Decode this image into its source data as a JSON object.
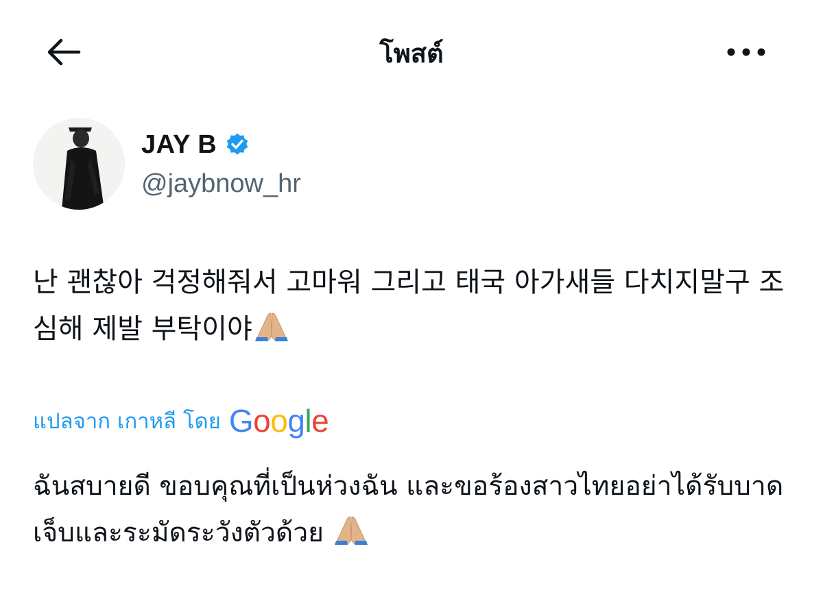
{
  "header": {
    "title": "โพสต์",
    "back_icon": "arrow-left-icon",
    "more_icon": "more-horizontal-icon"
  },
  "author": {
    "name": "JAY B",
    "handle": "@jaybnow_hr",
    "verified": true,
    "verified_color": "#1d9bf0"
  },
  "post": {
    "text": "난 괜찮아 걱정해줘서 고마워 그리고 태국 아가새들 다치지말구 조심해 제발 부탁이야",
    "emoji": "folded-hands-icon"
  },
  "translation": {
    "label": "แปลจาก เกาหลี โดย",
    "provider": "Google",
    "text": "ฉันสบายดี ขอบคุณที่เป็นห่วงฉัน และขอร้องสาวไทยอย่าได้รับบาดเจ็บและระมัดระวังตัวด้วย",
    "emoji": "folded-hands-icon",
    "link_color": "#1d9bf0"
  }
}
